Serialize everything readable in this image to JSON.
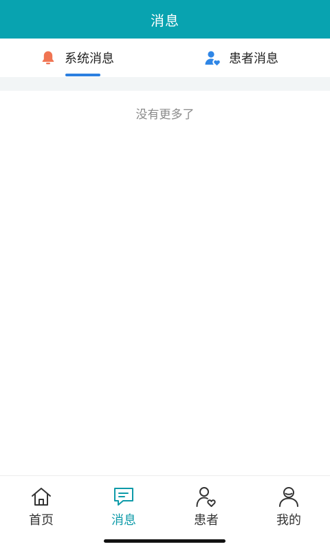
{
  "header": {
    "title": "消息"
  },
  "tabs": [
    {
      "label": "系统消息",
      "icon": "bell-icon",
      "active": true
    },
    {
      "label": "患者消息",
      "icon": "patient-heart-icon",
      "active": false
    }
  ],
  "content": {
    "empty_text": "没有更多了"
  },
  "bottom_nav": [
    {
      "label": "首页",
      "icon": "home-icon",
      "active": false
    },
    {
      "label": "消息",
      "icon": "message-icon",
      "active": true
    },
    {
      "label": "患者",
      "icon": "patient-icon",
      "active": false
    },
    {
      "label": "我的",
      "icon": "user-icon",
      "active": false
    }
  ],
  "colors": {
    "header_bg": "#08a3b0",
    "active_tab_indicator": "#2b7fe0",
    "bell_icon": "#f07452",
    "patient_icon": "#2f86e6",
    "nav_active": "#0d9aa8",
    "nav_inactive": "#333333"
  }
}
